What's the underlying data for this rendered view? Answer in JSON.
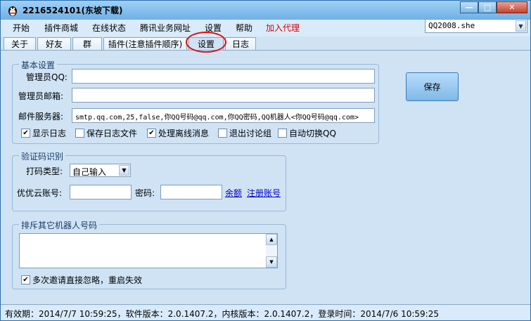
{
  "window": {
    "title": "2216524101(东坡下载)",
    "icon": "penguin-icon"
  },
  "menu": [
    "开始",
    "插件商城",
    "在线状态",
    "腾讯业务网址",
    "设置",
    "帮助",
    "加入代理"
  ],
  "combo": {
    "value": "QQ2008.she"
  },
  "tabs": [
    "关于",
    "好友",
    "群",
    "插件(注意插件顺序)",
    "设置",
    "日志"
  ],
  "basic": {
    "title": "基本设置",
    "admin_qq_label": "管理员QQ:",
    "admin_qq_value": "",
    "admin_email_label": "管理员邮箱:",
    "admin_email_value": "",
    "mail_server_label": "邮件服务器:",
    "mail_server_value": "smtp.qq.com,25,false,你QQ号码@qq.com,你QQ密码,QQ机器人<你QQ号码@qq.com>",
    "checks": [
      {
        "label": "显示日志",
        "checked": true
      },
      {
        "label": "保存日志文件",
        "checked": false
      },
      {
        "label": "处理离线消息",
        "checked": true
      },
      {
        "label": "退出讨论组",
        "checked": false
      },
      {
        "label": "自动切换QQ",
        "checked": false
      }
    ]
  },
  "save_label": "保存",
  "captcha": {
    "title": "验证码识别",
    "type_label": "打码类型:",
    "type_value": "自己输入",
    "account_label": "优优云账号:",
    "account_value": "",
    "password_label": "密码:",
    "password_value": "",
    "balance_link": "余额",
    "register_link": "注册账号"
  },
  "exclude": {
    "title": "排斥其它机器人号码",
    "value": "",
    "ignore_label": "多次邀请直接忽略，重启失效",
    "ignore_checked": true
  },
  "status": "有效期：2014/7/7 10:59:25，软件版本：2.0.1407.2，内核版本：2.0.1407.2，登录时间：2014/7/6 10:59:25",
  "colors": {
    "accent_red": "#e00000",
    "link": "#0000cc",
    "highlight_circle": "#e01010"
  }
}
